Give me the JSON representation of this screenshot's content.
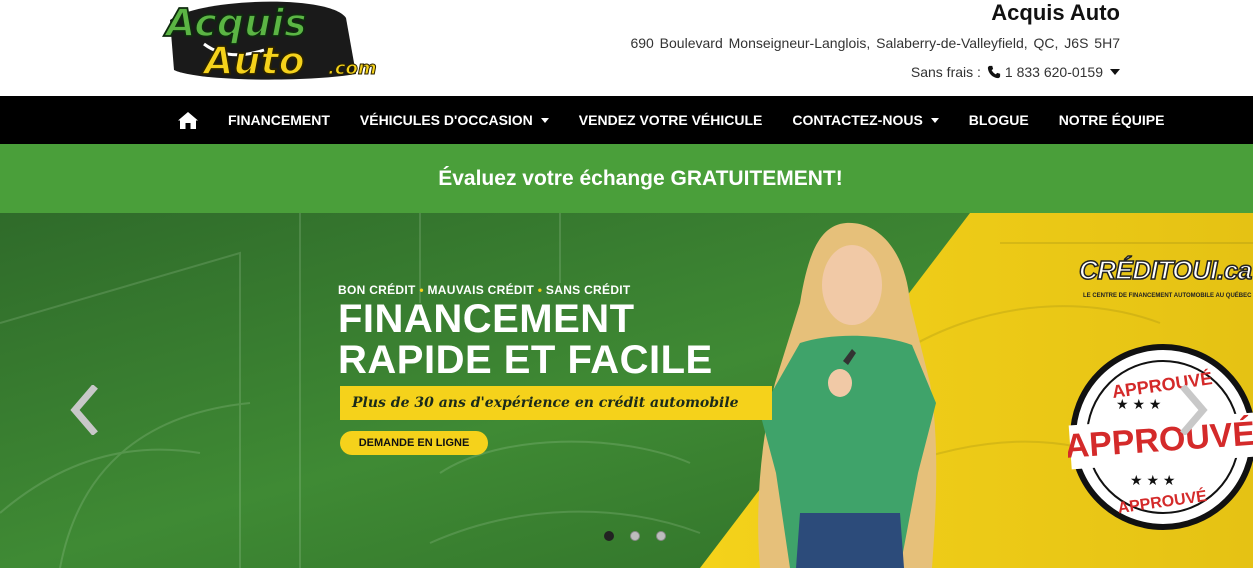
{
  "logo": {
    "line1": "Acquis",
    "line2": "Auto",
    "suffix": ".com"
  },
  "header": {
    "dealer_name": "Acquis Auto",
    "address": "690 Boulevard Monseigneur-Langlois,  Salaberry-de-Valleyfield,  QC,  J6S 5H7",
    "tollfree_label": "Sans frais :",
    "phone": "1 833 620-0159"
  },
  "nav": {
    "home_icon": "home-icon",
    "items": [
      {
        "label": "FINANCEMENT",
        "dropdown": false
      },
      {
        "label": "VÉHICULES D'OCCASION",
        "dropdown": true
      },
      {
        "label": "VENDEZ VOTRE VÉHICULE",
        "dropdown": false
      },
      {
        "label": "CONTACTEZ-NOUS",
        "dropdown": true
      },
      {
        "label": "BLOGUE",
        "dropdown": false
      },
      {
        "label": "NOTRE ÉQUIPE",
        "dropdown": false
      }
    ]
  },
  "promo": {
    "text": "Évaluez votre échange GRATUITEMENT!"
  },
  "hero": {
    "tagline_parts": [
      "BON CRÉDIT",
      "•",
      "MAUVAIS CRÉDIT",
      "•",
      "SANS CRÉDIT"
    ],
    "title_line1": "FINANCEMENT",
    "title_line2": "RAPIDE ET FACILE",
    "ribbon": "Plus de 30 ans d'expérience en crédit automobile",
    "cta": "DEMANDE EN LIGNE",
    "credit_brand": "CRÉDITOUI.ca",
    "credit_sub": "LE CENTRE DE FINANCEMENT AUTOMOBILE AU QUÉBEC",
    "stamp_top": "APPROUVÉ",
    "stamp_center": "APPROUVÉ",
    "stamp_bottom": "APPROUVÉ"
  },
  "carousel": {
    "slide_count": 3,
    "active_index": 0
  },
  "colors": {
    "brand_green": "#4a9f3a",
    "brand_yellow": "#f5d21b",
    "nav_bg": "#000000",
    "stamp_red": "#d42a2a"
  }
}
